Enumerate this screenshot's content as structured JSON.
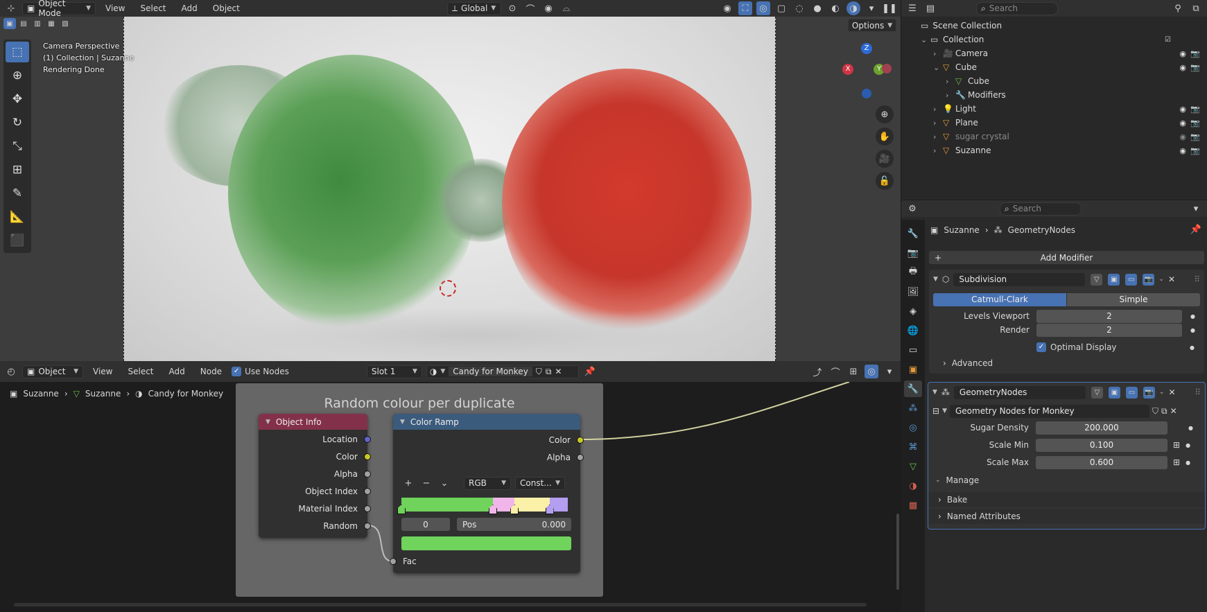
{
  "top_header": {
    "mode": "Object Mode",
    "menus": [
      "View",
      "Select",
      "Add",
      "Object"
    ],
    "transform_orientation": "Global"
  },
  "viewport": {
    "options_label": "Options",
    "info_lines": [
      "Camera Perspective",
      "(1) Collection | Suzanne",
      "Rendering Done"
    ],
    "gizmo_axes": [
      "X",
      "Y",
      "Z"
    ]
  },
  "node_header": {
    "editor_type": "Object",
    "menus": [
      "View",
      "Select",
      "Add",
      "Node"
    ],
    "use_nodes_label": "Use Nodes",
    "slot": "Slot 1",
    "material": "Candy for Monkey"
  },
  "node_breadcrumb": [
    "Suzanne",
    "Suzanne",
    "Candy for Monkey"
  ],
  "frame_title": "Random colour per duplicate",
  "object_info_node": {
    "title": "Object Info",
    "outputs": [
      "Location",
      "Color",
      "Alpha",
      "Object Index",
      "Material Index",
      "Random"
    ]
  },
  "color_ramp_node": {
    "title": "Color Ramp",
    "outputs": [
      "Color",
      "Alpha"
    ],
    "color_mode": "RGB",
    "interpolation": "Const...",
    "stop_index": "0",
    "pos_label": "Pos",
    "pos_value": "0.000",
    "input": "Fac",
    "stops": [
      {
        "pos": 0.0,
        "color": "#6fd35c"
      },
      {
        "pos": 0.55,
        "color": "#f0b6ea"
      },
      {
        "pos": 0.68,
        "color": "#fbf0a8"
      },
      {
        "pos": 0.89,
        "color": "#b39ef0"
      }
    ],
    "selected_color": "#6fd35c"
  },
  "outliner": {
    "search_placeholder": "Search",
    "scene_collection": "Scene Collection",
    "items": [
      {
        "label": "Collection",
        "depth": 0
      },
      {
        "label": "Camera",
        "depth": 1
      },
      {
        "label": "Cube",
        "depth": 1
      },
      {
        "label": "Cube",
        "depth": 2
      },
      {
        "label": "Modifiers",
        "depth": 2
      },
      {
        "label": "Light",
        "depth": 1
      },
      {
        "label": "Plane",
        "depth": 1
      },
      {
        "label": "sugar crystal",
        "depth": 1
      },
      {
        "label": "Suzanne",
        "depth": 1
      }
    ]
  },
  "properties": {
    "search_placeholder": "Search",
    "breadcrumb": [
      "Suzanne",
      "GeometryNodes"
    ],
    "add_modifier": "Add Modifier",
    "subdivision": {
      "name": "Subdivision",
      "methods": [
        "Catmull-Clark",
        "Simple"
      ],
      "levels_viewport_label": "Levels Viewport",
      "levels_viewport": "2",
      "render_label": "Render",
      "render": "2",
      "optimal_display": "Optimal Display",
      "advanced": "Advanced"
    },
    "geonodes": {
      "name": "GeometryNodes",
      "node_group": "Geometry Nodes for Monkey",
      "sugar_density_label": "Sugar Density",
      "sugar_density": "200.000",
      "scale_min_label": "Scale Min",
      "scale_min": "0.100",
      "scale_max_label": "Scale Max",
      "scale_max": "0.600",
      "manage": "Manage",
      "bake": "Bake",
      "named_attributes": "Named Attributes"
    }
  },
  "colors": {
    "accent": "#4772b3",
    "object_info_header": "#83314a",
    "color_ramp_header": "#3b5b7d",
    "socket_yellow": "#c7c729",
    "socket_purple": "#6363c7",
    "socket_gray": "#a1a1a1"
  }
}
